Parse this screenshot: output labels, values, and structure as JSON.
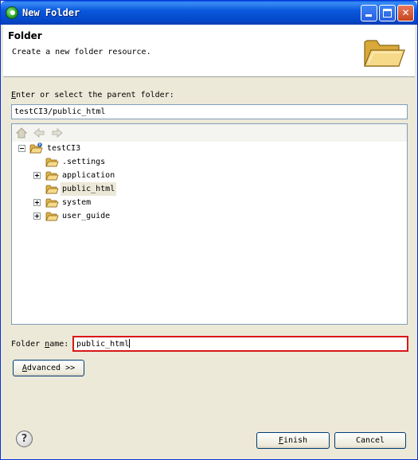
{
  "window": {
    "title": "New Folder",
    "buttons": [
      "minimize",
      "maximize",
      "close"
    ],
    "accent": "#0a59dc"
  },
  "banner": {
    "title": "Folder",
    "description": "Create a new folder resource.",
    "icon": "folder-open-icon"
  },
  "parent_folder": {
    "label_prefix": "E",
    "label_rest": "nter or select the parent folder:",
    "value": "testCI3/public_html"
  },
  "tree": {
    "toolbar_icons": [
      "home-icon",
      "back-arrow-icon",
      "forward-arrow-icon"
    ],
    "root": {
      "label": "testCI3",
      "expanded": true
    },
    "items": [
      {
        "label": ".settings",
        "expandable": false,
        "selected": false
      },
      {
        "label": "application",
        "expandable": true,
        "selected": false
      },
      {
        "label": "public_html",
        "expandable": false,
        "selected": true
      },
      {
        "label": "system",
        "expandable": true,
        "selected": false
      },
      {
        "label": "user_guide",
        "expandable": true,
        "selected": false
      }
    ]
  },
  "folder_name": {
    "label_prefix": "Folder ",
    "label_mnemonic": "n",
    "label_rest": "ame:",
    "value": "public_html",
    "highlight_color": "#d81818"
  },
  "buttons": {
    "advanced_mnemonic": "A",
    "advanced_rest": "dvanced >>",
    "finish_mnemonic": "F",
    "finish_rest": "inish",
    "cancel": "Cancel"
  }
}
